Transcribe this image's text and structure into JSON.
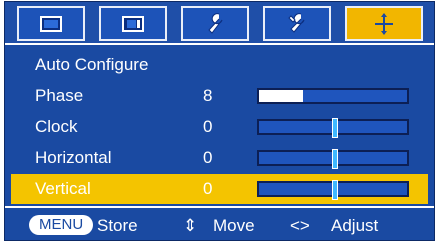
{
  "tabs": [
    {
      "icon": "picture-icon",
      "active": false
    },
    {
      "icon": "screen-icon",
      "active": false
    },
    {
      "icon": "wrench-icon",
      "active": false
    },
    {
      "icon": "tools-icon",
      "active": false
    },
    {
      "icon": "crosshair-icon",
      "active": true
    }
  ],
  "menu": {
    "title": "Auto Configure",
    "items": [
      {
        "label": "Phase",
        "value": "8",
        "level": 0.3
      },
      {
        "label": "Clock",
        "value": "0",
        "level": 0.5
      },
      {
        "label": "Horizontal",
        "value": "0",
        "level": 0.5
      },
      {
        "label": "Vertical",
        "value": "0",
        "level": 0.5,
        "selected": true
      }
    ]
  },
  "footer": {
    "menu_key": "MENU",
    "store": "Store",
    "move_symbol": "⇕",
    "move": "Move",
    "adjust_symbol": "<>",
    "adjust": "Adjust"
  },
  "colors": {
    "panel": "#1a4aa2",
    "highlight": "#f4c400",
    "active_tab": "#f2b600",
    "marker": "#3fb8ff"
  }
}
